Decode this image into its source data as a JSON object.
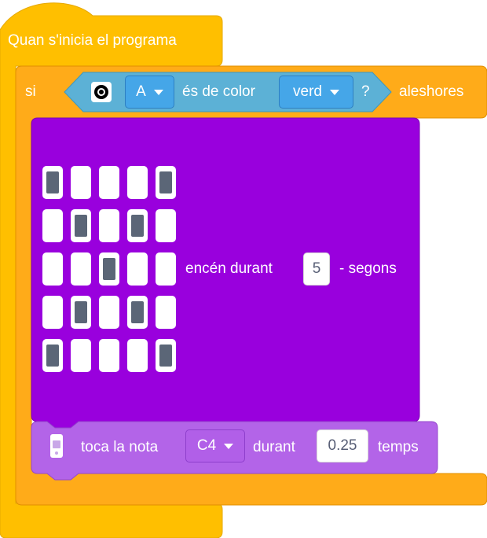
{
  "hat_block": {
    "label": "Quan s'inicia el programa",
    "color": "#ffbf00"
  },
  "if_block": {
    "label_if": "si",
    "label_then": "aleshores",
    "color": "#ffab19",
    "condition": {
      "color": "#5cb1d6",
      "sensor_icon": "color-sensor-icon",
      "port_value": "A",
      "text": "és de color",
      "color_value": "verd",
      "question": "?"
    }
  },
  "matrix_block": {
    "color": "#9900dd",
    "pattern": [
      [
        1,
        0,
        0,
        0,
        1
      ],
      [
        0,
        1,
        0,
        1,
        0
      ],
      [
        0,
        0,
        1,
        0,
        0
      ],
      [
        0,
        1,
        0,
        1,
        0
      ],
      [
        1,
        0,
        0,
        0,
        1
      ]
    ],
    "label_on": "encén durant",
    "duration": "5",
    "label_unit": "- segons"
  },
  "note_block": {
    "color": "#b364e8",
    "icon": "hub-icon",
    "label_play": "toca la nota",
    "note_value": "C4",
    "label_for": "durant",
    "beats": "0.25",
    "label_beats": "temps"
  }
}
